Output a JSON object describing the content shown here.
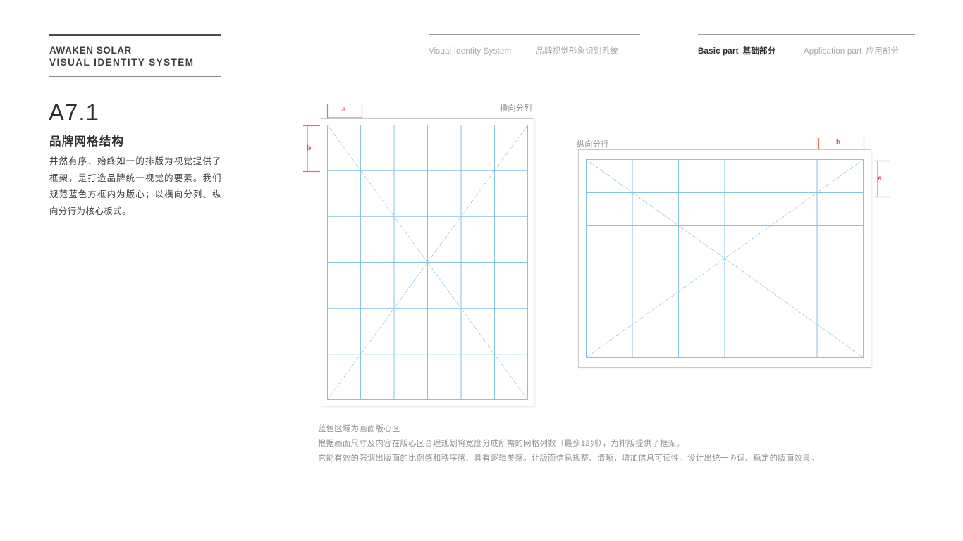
{
  "header": {
    "brand_name": "AWAKEN SOLAR",
    "brand_sub": "VISUAL IDENTITY SYSTEM",
    "nav_left": [
      {
        "en": "Visual Identity System",
        "cn": ""
      },
      {
        "en": "",
        "cn": "品牌视觉形象识别系统"
      }
    ],
    "nav_right": [
      {
        "en": "Basic part",
        "cn": "基础部分",
        "active": true
      },
      {
        "en": "Application part",
        "cn": "应用部分",
        "active": false
      }
    ]
  },
  "section": {
    "code": "A7.1",
    "title": "品牌网格结构",
    "body": "井然有序、始终如一的排版为视觉提供了框架，是打造品牌统一视觉的要素。我们规范蓝色方框内为版心；以横向分列、纵向分行为核心板式。"
  },
  "diagrams": {
    "portrait": {
      "caption": "横向分列",
      "dim_horizontal": "a",
      "dim_vertical": "b",
      "columns": 6,
      "rows": 6,
      "diagonals": true
    },
    "landscape": {
      "caption": "纵向分行",
      "dim_horizontal": "b",
      "dim_vertical": "a",
      "columns": 6,
      "rows": 6,
      "diagonals": true
    }
  },
  "notes": [
    "蓝色区域为画面版心区",
    "根据画面尺寸及内容在版心区合理规划将宽度分成所需的网格列数（最多12列），为排版提供了框架。",
    "它能有效的强调出版面的比例感和秩序感、具有逻辑美感。让版面信息规整、清晰，增加信息可读性。设计出统一协调、稳定的版面效果。"
  ],
  "colors": {
    "grid_line": "#86c2e6",
    "grid_line_light": "#b5dcf0",
    "frame": "#c9c9c9",
    "dimension": "#ef6f63",
    "dimension_label": "#e8453c",
    "text_primary": "#2f2f2f",
    "text_muted": "#939393"
  }
}
